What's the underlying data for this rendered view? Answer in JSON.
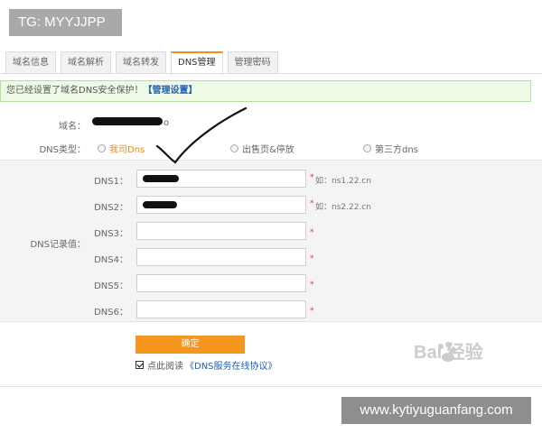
{
  "overlay": {
    "tg_label": "TG: MYYJJPP",
    "site_label": "www.kytiyuguanfang.com",
    "baidu_label": "Bai  经验"
  },
  "tabs": [
    {
      "label": "域名信息",
      "active": false
    },
    {
      "label": "域名解析",
      "active": false
    },
    {
      "label": "域名转发",
      "active": false
    },
    {
      "label": "DNS管理",
      "active": true
    },
    {
      "label": "管理密码",
      "active": false
    }
  ],
  "notice": {
    "text": "您已经设置了域名DNS安全保护！",
    "link": "【管理设置】"
  },
  "form": {
    "domain_label": "域名：",
    "domain_suffix": "o",
    "dns_type_label": "DNS类型：",
    "dns_type_options": [
      "我司Dns",
      "出售页&停放",
      "第三方dns"
    ],
    "dns_type_selected": "我司Dns",
    "dns_record_label": "DNS记录值：",
    "dns_rows": [
      {
        "label": "DNS1：",
        "hint": "如：ns1.22.cn"
      },
      {
        "label": "DNS2：",
        "hint": "如：ns2.22.cn"
      },
      {
        "label": "DNS3：",
        "hint": ""
      },
      {
        "label": "DNS4：",
        "hint": ""
      },
      {
        "label": "DNS5：",
        "hint": ""
      },
      {
        "label": "DNS6：",
        "hint": ""
      }
    ],
    "required_mark": "*",
    "submit_label": "确定",
    "agree_checked": true,
    "agree_text": "点此阅读",
    "agree_link": "《DNS服务在线协议》"
  },
  "colors": {
    "accent": "#f5961e",
    "link": "#2260b4",
    "notice_bg": "#eefae6"
  }
}
